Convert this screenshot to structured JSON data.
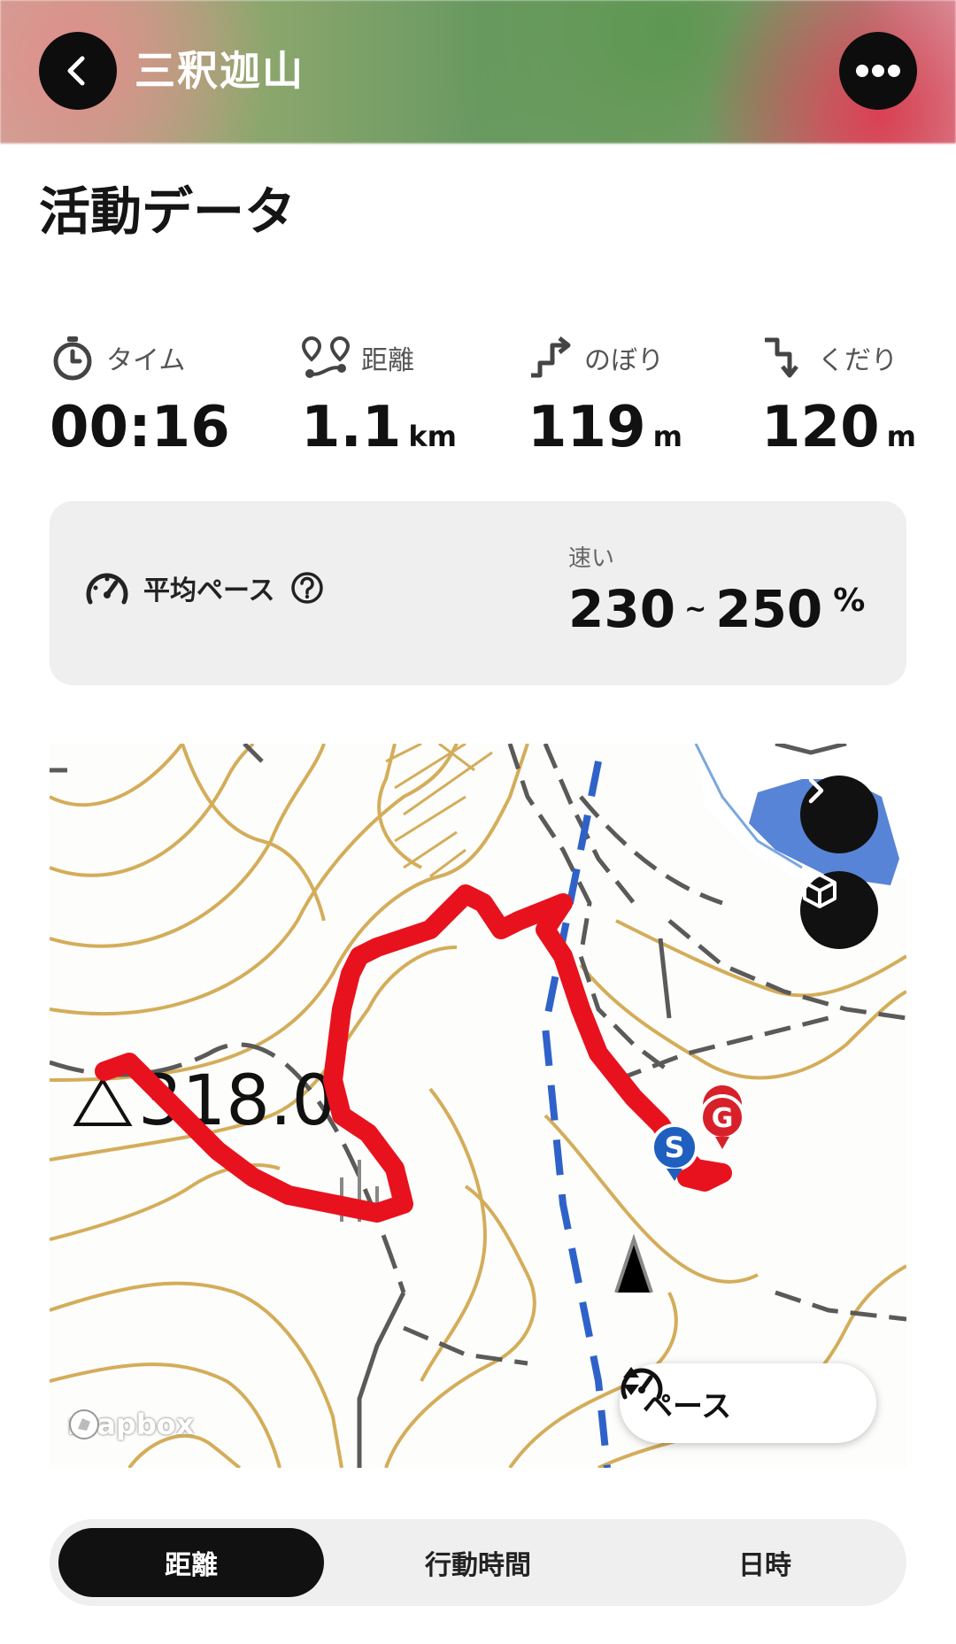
{
  "header": {
    "title": "三釈迦山",
    "back_icon": "chevron-left-icon",
    "more_icon": "ellipsis-icon"
  },
  "section_title": "活動データ",
  "stats": [
    {
      "icon": "stopwatch-icon",
      "label": "タイム",
      "value": "00:16",
      "unit": ""
    },
    {
      "icon": "route-icon",
      "label": "距離",
      "value": "1.1",
      "unit": "km"
    },
    {
      "icon": "ascent-icon",
      "label": "のぼり",
      "value": "119",
      "unit": "m"
    },
    {
      "icon": "descent-icon",
      "label": "くだり",
      "value": "120",
      "unit": "m"
    }
  ],
  "pace": {
    "icon": "speedometer-icon",
    "label": "平均ペース",
    "help_icon": "question-circle-icon",
    "category": "速い",
    "range_low": "230",
    "tilde": "~",
    "range_high": "250",
    "unit": "%"
  },
  "map": {
    "summit_label": "318.0",
    "start_marker": "S",
    "goal_marker": "G",
    "next_icon": "chevron-right-icon",
    "view_3d_icon": "cube-icon",
    "pace_selector_label": "ペース",
    "attribution": "mapbox",
    "colors": {
      "route": "#e8121e",
      "contour": "#d4ad5a",
      "water": "#2f62c9",
      "road": "#5a5a5a",
      "start": "#1f5fc0",
      "goal": "#d8202a"
    }
  },
  "segments": [
    {
      "label": "距離",
      "active": true
    },
    {
      "label": "行動時間",
      "active": false
    },
    {
      "label": "日時",
      "active": false
    }
  ]
}
